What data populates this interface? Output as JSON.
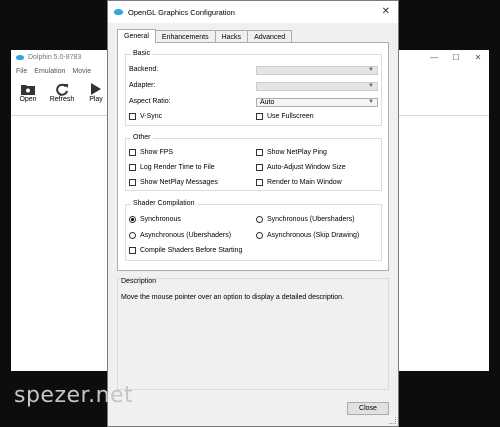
{
  "background_window": {
    "title": "Dolphin 5.0-8783",
    "menu": [
      "File",
      "Emulation",
      "Movie"
    ],
    "toolbar": [
      {
        "label": "Open",
        "icon": "folder-icon"
      },
      {
        "label": "Refresh",
        "icon": "refresh-icon"
      },
      {
        "label": "Play",
        "icon": "play-icon"
      }
    ],
    "caption": {
      "minimize": "—",
      "maximize": "☐",
      "close": "✕"
    }
  },
  "dialog": {
    "title": "OpenGL Graphics Configuration",
    "close_glyph": "✕",
    "tabs": [
      "General",
      "Enhancements",
      "Hacks",
      "Advanced"
    ],
    "active_tab": "General",
    "basic": {
      "title": "Basic",
      "backend_label": "Backend:",
      "backend_value": "",
      "adapter_label": "Adapter:",
      "adapter_value": "",
      "aspect_label": "Aspect Ratio:",
      "aspect_value": "Auto",
      "vsync_label": "V-Sync",
      "vsync_checked": false,
      "fullscreen_label": "Use Fullscreen",
      "fullscreen_checked": false
    },
    "other": {
      "title": "Other",
      "items": [
        {
          "label": "Show FPS",
          "checked": false
        },
        {
          "label": "Show NetPlay Ping",
          "checked": false
        },
        {
          "label": "Log Render Time to File",
          "checked": false
        },
        {
          "label": "Auto-Adjust Window Size",
          "checked": false
        },
        {
          "label": "Show NetPlay Messages",
          "checked": false
        },
        {
          "label": "Render to Main Window",
          "checked": false
        }
      ]
    },
    "shader": {
      "title": "Shader Compilation",
      "options": [
        {
          "label": "Synchronous",
          "selected": true
        },
        {
          "label": "Synchronous (Ubershaders)",
          "selected": false
        },
        {
          "label": "Asynchronous (Ubershaders)",
          "selected": false
        },
        {
          "label": "Asynchronous (Skip Drawing)",
          "selected": false
        }
      ],
      "precompile_label": "Compile Shaders Before Starting",
      "precompile_checked": false
    },
    "description": {
      "title": "Description",
      "text": "Move the mouse pointer over an option to display a detailed description."
    },
    "close_button": "Close"
  },
  "watermark": "spezer.net",
  "colors": {
    "dolphin_blue": "#2ea7dd",
    "panel_bg": "#f0f0f0"
  }
}
